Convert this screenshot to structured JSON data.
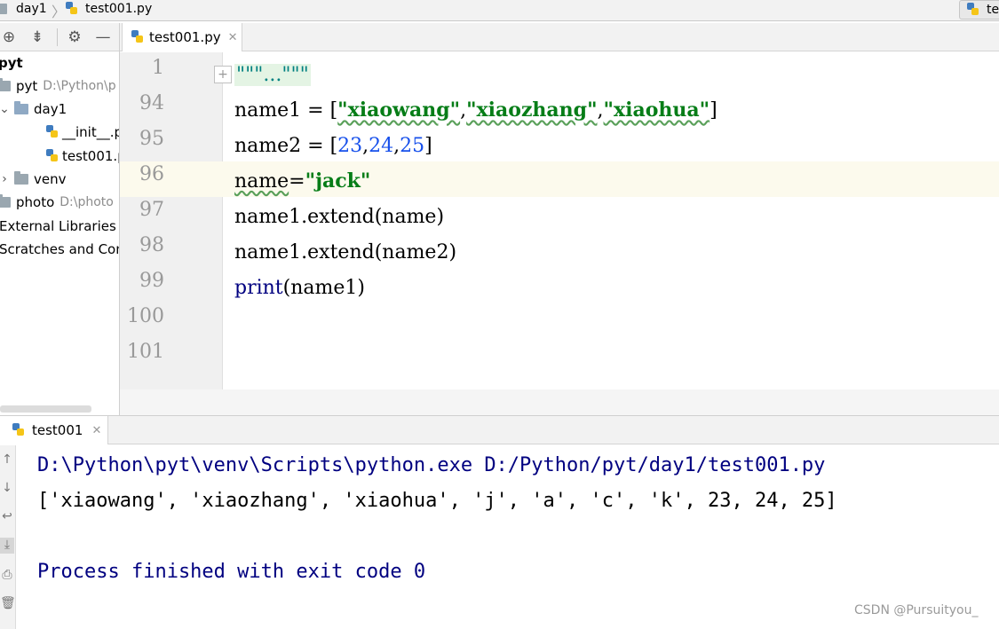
{
  "breadcrumb": {
    "folder": "day1",
    "file": "test001.py"
  },
  "run_config": {
    "label": "te"
  },
  "project_toolbar": {
    "icons": [
      "target-icon",
      "collapse-icon",
      "gear-icon",
      "minimize-icon"
    ]
  },
  "project_tree": {
    "root_label": "pyt",
    "items": [
      {
        "label": "pyt",
        "hint": "D:\\Python\\p"
      },
      {
        "label": "day1"
      },
      {
        "label": "__init__.p"
      },
      {
        "label": "test001.p"
      },
      {
        "label": "venv"
      },
      {
        "label": "photo",
        "hint": "D:\\photo"
      },
      {
        "label": "External Libraries"
      },
      {
        "label": "Scratches and Cons"
      }
    ]
  },
  "editor": {
    "tab_label": "test001.py",
    "line_numbers": [
      "1",
      "94",
      "95",
      "96",
      "97",
      "98",
      "99",
      "100",
      "101"
    ],
    "current_line": "96",
    "code": {
      "l1_docstring": "\"\"\"...\"\"\"",
      "l94_a": "name1 = [",
      "l94_s1": "\"xiaowang\"",
      "l94_c1": ",",
      "l94_s2": "\"xiaozhang\"",
      "l94_c2": ",",
      "l94_s3": "\"xiaohua\"",
      "l94_b": "]",
      "l95_a": "name2 = [",
      "l95_n1": "23",
      "l95_c1": ",",
      "l95_n2": "24",
      "l95_c2": ",",
      "l95_n3": "25",
      "l95_b": "]",
      "l96_a": "name",
      "l96_eq": "=",
      "l96_s": "\"jack\"",
      "l97": "name1.extend(name)",
      "l98": "name1.extend(name2)",
      "l99_fn": "print",
      "l99_rest": "(name1)"
    }
  },
  "run": {
    "tab_label": "test001",
    "side_icons": [
      "up-arrow-icon",
      "down-arrow-icon",
      "soft-wrap-icon",
      "scroll-to-end-icon",
      "print-icon",
      "trash-icon"
    ],
    "console": [
      "D:\\Python\\pyt\\venv\\Scripts\\python.exe D:/Python/pyt/day1/test001.py",
      "['xiaowang', 'xiaozhang', 'xiaohua', 'j', 'a', 'c', 'k', 23, 24, 25]",
      "Process finished with exit code 0"
    ]
  },
  "watermark": "CSDN @Pursuityou_",
  "colors": {
    "string": "#067d17",
    "number": "#1750eb",
    "system_output": "#000080",
    "current_line_bg": "#fcfaed",
    "docstring_bg": "#e4f4e4"
  }
}
